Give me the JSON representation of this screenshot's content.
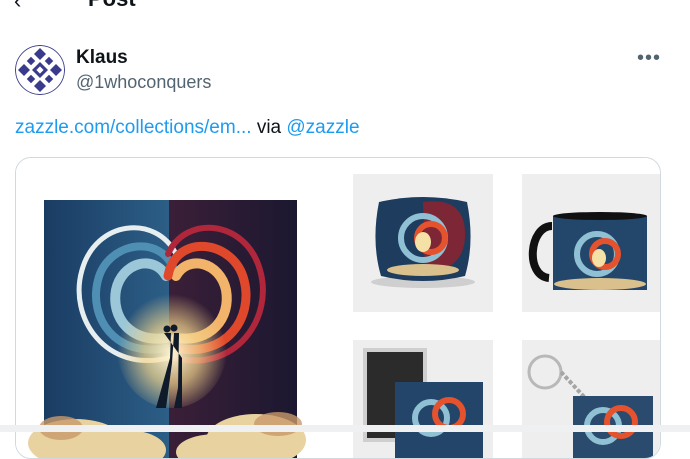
{
  "header": {
    "back_icon": "back-arrow-icon",
    "title": "Post"
  },
  "author": {
    "name": "Klaus",
    "handle": "@1whoconquers"
  },
  "post": {
    "link_text": "zazzle.com/collections/em...",
    "via": "via",
    "mention": "@zazzle"
  },
  "media": {
    "items": [
      {
        "label": "main-artwork"
      },
      {
        "label": "pillow-product"
      },
      {
        "label": "mug-product"
      },
      {
        "label": "magnet-product"
      },
      {
        "label": "keychain-product"
      }
    ]
  },
  "colors": {
    "link": "#1d9bf0",
    "secondary_text": "#536471",
    "border": "#cfd9de"
  }
}
